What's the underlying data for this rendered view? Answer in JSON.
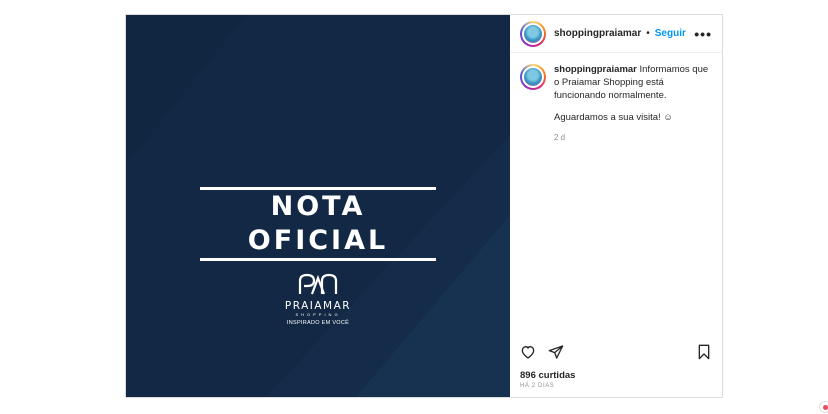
{
  "post": {
    "image": {
      "headline": "NOTA OFICIAL",
      "logo": {
        "brand": "PRAIAMAR",
        "subbrand": "SHOPPING",
        "tagline": "INSPIRADO EM VOCÊ"
      },
      "background_color": "#132845"
    },
    "header": {
      "username": "shoppingpraiamar",
      "separator": "•",
      "follow_label": "Seguir",
      "more_label": "•••"
    },
    "caption": {
      "username": "shoppingpraiamar",
      "text": " Informamos que o Praiamar Shopping está funcionando normalmente.",
      "text2": "Aguardamos a sua visita! ☺",
      "age": "2 d"
    },
    "actions": {
      "like_icon": "heart-icon",
      "share_icon": "send-icon",
      "save_icon": "bookmark-icon"
    },
    "likes": "896 curtidas",
    "posted": "HÁ 2 DIAS"
  },
  "colors": {
    "accent": "#0095f6",
    "muted": "#8e8e8e",
    "border": "#dbdbdb"
  }
}
